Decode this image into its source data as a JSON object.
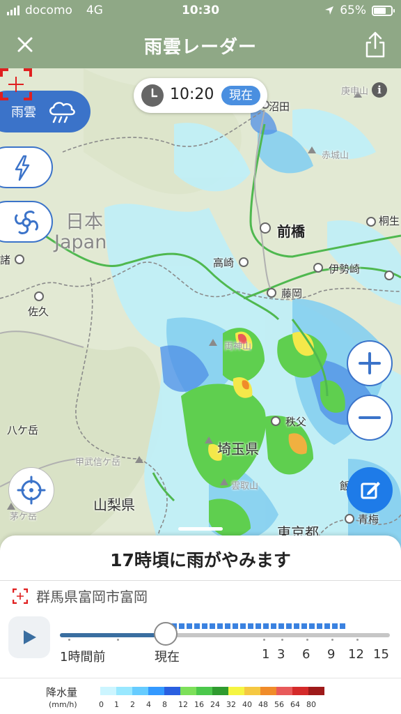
{
  "status_bar": {
    "carrier": "docomo",
    "network": "4G",
    "time": "10:30",
    "battery": "65%"
  },
  "header": {
    "title": "雨雲レーダー"
  },
  "map": {
    "time": "10:20",
    "now_badge": "現在",
    "layers": {
      "rain_label": "雨雲"
    },
    "labels": {
      "numata": "沼田",
      "maebashi": "前橋",
      "takasaki": "高崎",
      "isesaki": "伊勢崎",
      "fujioka": "藤岡",
      "chichibu": "秩父",
      "saitama": "埼玉県",
      "yamanashi": "山梨県",
      "saku": "佐久",
      "yatsugatake": "八ケ岳",
      "kobushigatake": "甲武信ケ岳",
      "kumotori": "雲取山",
      "tokyo": "東京都",
      "ome": "青梅",
      "akagi": "赤城山",
      "kosha": "庚申山",
      "kiryu": "桐生",
      "kai_koma": "茅ケ岳",
      "suwa": "諸",
      "nihon": "日本",
      "japan": "Japan",
      "ryokami": "両神山",
      "hanno": "飯"
    }
  },
  "sheet": {
    "message": "17時頃に雨がやみます",
    "location": "群馬県富岡市富岡",
    "progress": 0.32,
    "ticks": [
      "1時間前",
      "現在",
      "1",
      "3",
      "6",
      "9",
      "12",
      "15"
    ]
  },
  "legend": {
    "title": "降水量",
    "unit": "(mm/h)",
    "values": [
      "0",
      "1",
      "2",
      "4",
      "8",
      "12",
      "16",
      "24",
      "32",
      "40",
      "48",
      "56",
      "64",
      "80"
    ],
    "colors": [
      "#ccf5ff",
      "#99e8ff",
      "#66ccff",
      "#3399ff",
      "#2a5fe0",
      "#7de05a",
      "#4cc84c",
      "#2f9b2f",
      "#f5f542",
      "#f5c842",
      "#f08c2a",
      "#e85a5a",
      "#d42a2a",
      "#9e1a1a"
    ]
  }
}
